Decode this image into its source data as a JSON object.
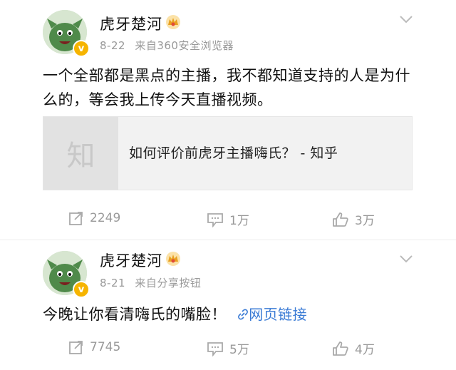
{
  "posts": [
    {
      "author": "虎牙楚河",
      "date": "8-22",
      "source": "来自360安全浏览器",
      "text": "一个全部都是黑点的主播，我不都知道支持的人是为什么的，等会我上传今天直播视频。",
      "card": {
        "thumb_text": "知",
        "title": "如何评价前虎牙主播嗨氏？ - 知乎"
      },
      "repost_count": "2249",
      "comment_count": "1万",
      "like_count": "3万"
    },
    {
      "author": "虎牙楚河",
      "date": "8-21",
      "source": "来自分享按钮",
      "text": "今晚让你看清嗨氏的嘴脸！",
      "link_text": "网页链接",
      "repost_count": "7745",
      "comment_count": "5万",
      "like_count": "4万"
    }
  ],
  "colors": {
    "accent_link": "#3a7bd5",
    "verified_badge": "#f6b400",
    "muted": "#999999"
  },
  "icons": [
    "avatar-image",
    "verified-badge-icon",
    "vip-crown-icon",
    "chevron-down-icon",
    "repost-icon",
    "comment-icon",
    "like-icon",
    "link-icon"
  ]
}
